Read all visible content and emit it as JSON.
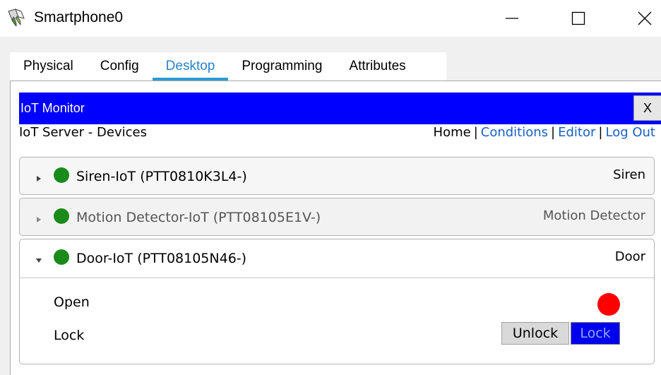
{
  "window": {
    "title": "Smartphone0"
  },
  "tabs": [
    {
      "label": "Physical",
      "active": false
    },
    {
      "label": "Config",
      "active": false
    },
    {
      "label": "Desktop",
      "active": true
    },
    {
      "label": "Programming",
      "active": false
    },
    {
      "label": "Attributes",
      "active": false
    }
  ],
  "monitor": {
    "title": "IoT Monitor",
    "close_label": "X",
    "bar_color": "#0000ff"
  },
  "server": {
    "label": "IoT Server - Devices"
  },
  "nav": {
    "home": "Home",
    "separator": "|",
    "conditions": "Conditions",
    "editor": "Editor",
    "logout": "Log Out"
  },
  "devices": [
    {
      "name": "Siren-IoT (PTT0810K3L4-)",
      "type": "Siren",
      "expanded": false,
      "status_color": "#1a8a1a"
    },
    {
      "name": "Motion Detector-IoT (PTT08105E1V-)",
      "type": "Motion Detector",
      "expanded": false,
      "status_color": "#1a8a1a"
    },
    {
      "name": "Door-IoT (PTT08105N46-)",
      "type": "Door",
      "expanded": true,
      "status_color": "#1a8a1a",
      "properties": {
        "open_label": "Open",
        "open_indicator_color": "#ff0000",
        "lock_label": "Lock",
        "unlock_button": "Unlock",
        "lock_button": "Lock"
      }
    }
  ],
  "icons": {
    "app": "smartphone-app-icon",
    "minimize": "minimize-icon",
    "maximize": "maximize-icon",
    "close": "close-icon",
    "collapsed": "caret-right-icon",
    "expanded": "caret-down-icon"
  }
}
